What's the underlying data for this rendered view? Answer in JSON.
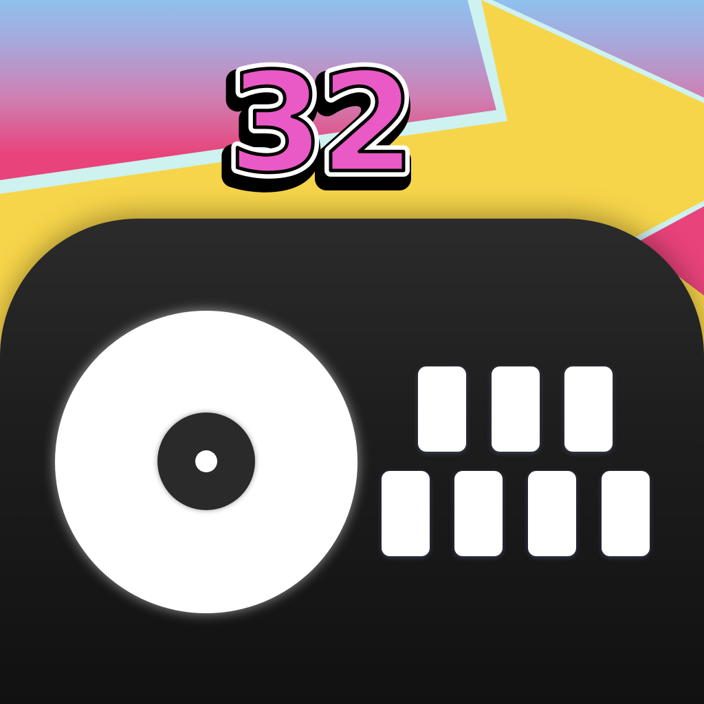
{
  "app_icon": {
    "badge_number": "32",
    "icons": {
      "background": "arrow-banner-icon",
      "device": "dj-controller-icon",
      "turntable": "vinyl-record-icon",
      "pads": "drum-pad-icon"
    },
    "pads_top_row_count": 3,
    "pads_bottom_row_count": 4,
    "colors": {
      "sky_blue": "#8fc1ee",
      "pink": "#e8437a",
      "yellow": "#f7d54a",
      "outline": "#cdf2f0",
      "badge_fill": "#e95ac6",
      "badge_stroke": "#000000",
      "device_body": "#1e1e1e",
      "accent_white": "#ffffff"
    }
  }
}
